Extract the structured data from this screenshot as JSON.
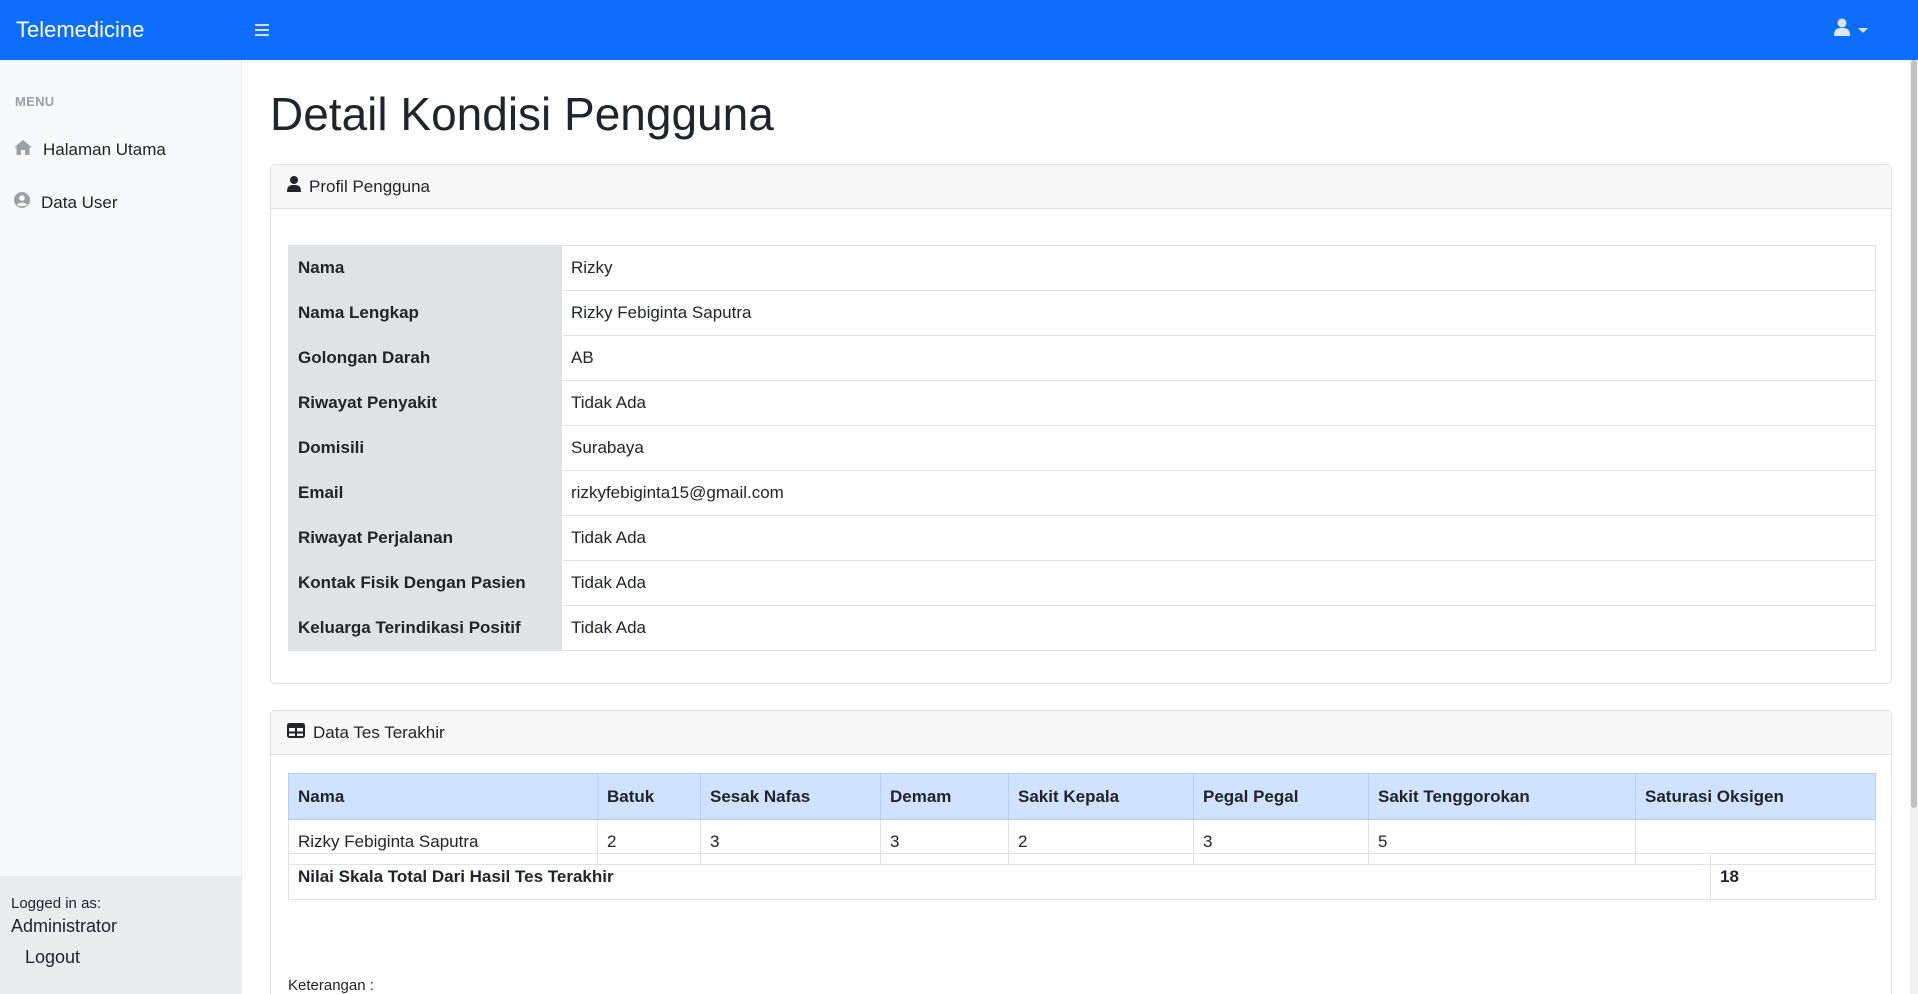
{
  "navbar": {
    "brand": "Telemedicine",
    "toggle_icon": "hamburger-icon",
    "user_icon": "user-icon",
    "color": "#0d6efd"
  },
  "sidebar": {
    "heading": "MENU",
    "items": [
      {
        "label": "Halaman Utama",
        "icon": "home-icon"
      },
      {
        "label": "Data User",
        "icon": "user-circle-icon"
      }
    ],
    "footer": {
      "logged_label": "Logged in as:",
      "user": "Administrator",
      "logout": "Logout"
    }
  },
  "page": {
    "title": "Detail Kondisi Pengguna"
  },
  "profile": {
    "header": "Profil Pengguna",
    "rows": [
      {
        "label": "Nama",
        "value": "Rizky"
      },
      {
        "label": "Nama Lengkap",
        "value": "Rizky Febiginta Saputra"
      },
      {
        "label": "Golongan Darah",
        "value": "AB"
      },
      {
        "label": "Riwayat Penyakit",
        "value": "Tidak Ada"
      },
      {
        "label": "Domisili",
        "value": "Surabaya"
      },
      {
        "label": "Email",
        "value": "rizkyfebiginta15@gmail.com"
      },
      {
        "label": "Riwayat Perjalanan",
        "value": "Tidak Ada"
      },
      {
        "label": "Kontak Fisik Dengan Pasien",
        "value": "Tidak Ada"
      },
      {
        "label": "Keluarga Terindikasi Positif",
        "value": "Tidak Ada"
      }
    ]
  },
  "tests": {
    "header": "Data Tes Terakhir",
    "columns": [
      "Nama",
      "Batuk",
      "Sesak Nafas",
      "Demam",
      "Sakit Kepala",
      "Pegal Pegal",
      "Sakit Tenggorokan",
      "Saturasi Oksigen"
    ],
    "row": [
      "Rizky Febiginta Saputra",
      "2",
      "3",
      "3",
      "2",
      "3",
      "5",
      ""
    ],
    "total_label": "Nilai Skala Total Dari Hasil Tes Terakhir",
    "total_value": "18",
    "note": "Keterangan :"
  }
}
